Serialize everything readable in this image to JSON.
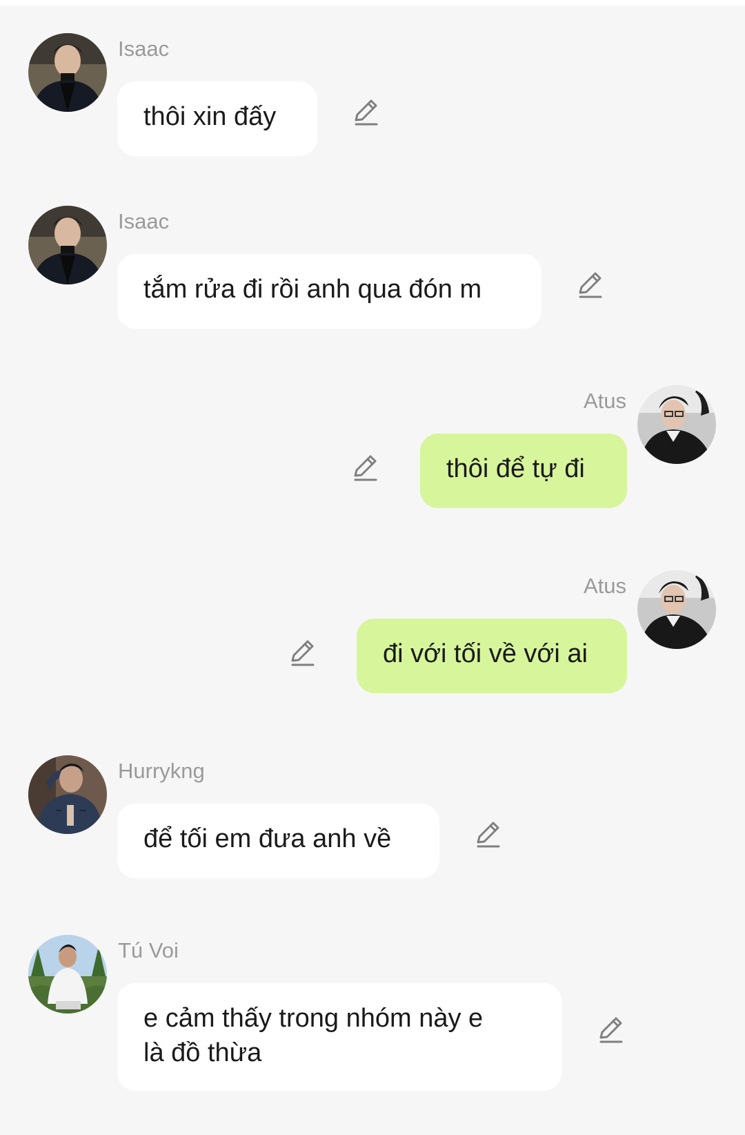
{
  "colors": {
    "background": "#f6f6f6",
    "incoming_bubble": "#ffffff",
    "outgoing_bubble": "#d7f59a",
    "sender_name": "#9a9a9a",
    "message_text": "#1a1a1a",
    "edit_icon": "#7f7f7f"
  },
  "messages": [
    {
      "sender": "Isaac",
      "direction": "incoming",
      "text": "thôi xin đấy",
      "icon": "pencil-icon"
    },
    {
      "sender": "Isaac",
      "direction": "incoming",
      "text": "tắm rửa đi rồi anh qua đón m",
      "icon": "pencil-icon"
    },
    {
      "sender": "Atus",
      "direction": "outgoing",
      "text": "thôi để tự đi",
      "icon": "pencil-icon"
    },
    {
      "sender": "Atus",
      "direction": "outgoing",
      "text": "đi với tối về với ai",
      "icon": "pencil-icon"
    },
    {
      "sender": "Hurrykng",
      "direction": "incoming",
      "text": "để tối em đưa anh về",
      "icon": "pencil-icon"
    },
    {
      "sender": "Tú Voi",
      "direction": "incoming",
      "text_lines": [
        "e cảm thấy trong nhóm này e",
        "là đồ thừa"
      ],
      "icon": "pencil-icon"
    }
  ]
}
